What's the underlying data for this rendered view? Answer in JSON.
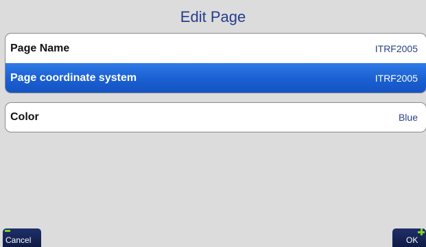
{
  "header": {
    "title": "Edit Page"
  },
  "fields": [
    {
      "label": "Page Name",
      "value": "ITRF2005"
    },
    {
      "label": "Page coordinate system",
      "value": "ITRF2005",
      "selected": true
    },
    {
      "label": "Color",
      "value": "Blue"
    }
  ],
  "softkeys": {
    "cancel_label": "Cancel",
    "ok_label": "OK"
  },
  "colors": {
    "background": "#dcdcdc",
    "title": "#243c8c",
    "selection": "#1a5fd2",
    "softkey": "#0f1b45",
    "softkey_indicator": "#7ed321"
  }
}
